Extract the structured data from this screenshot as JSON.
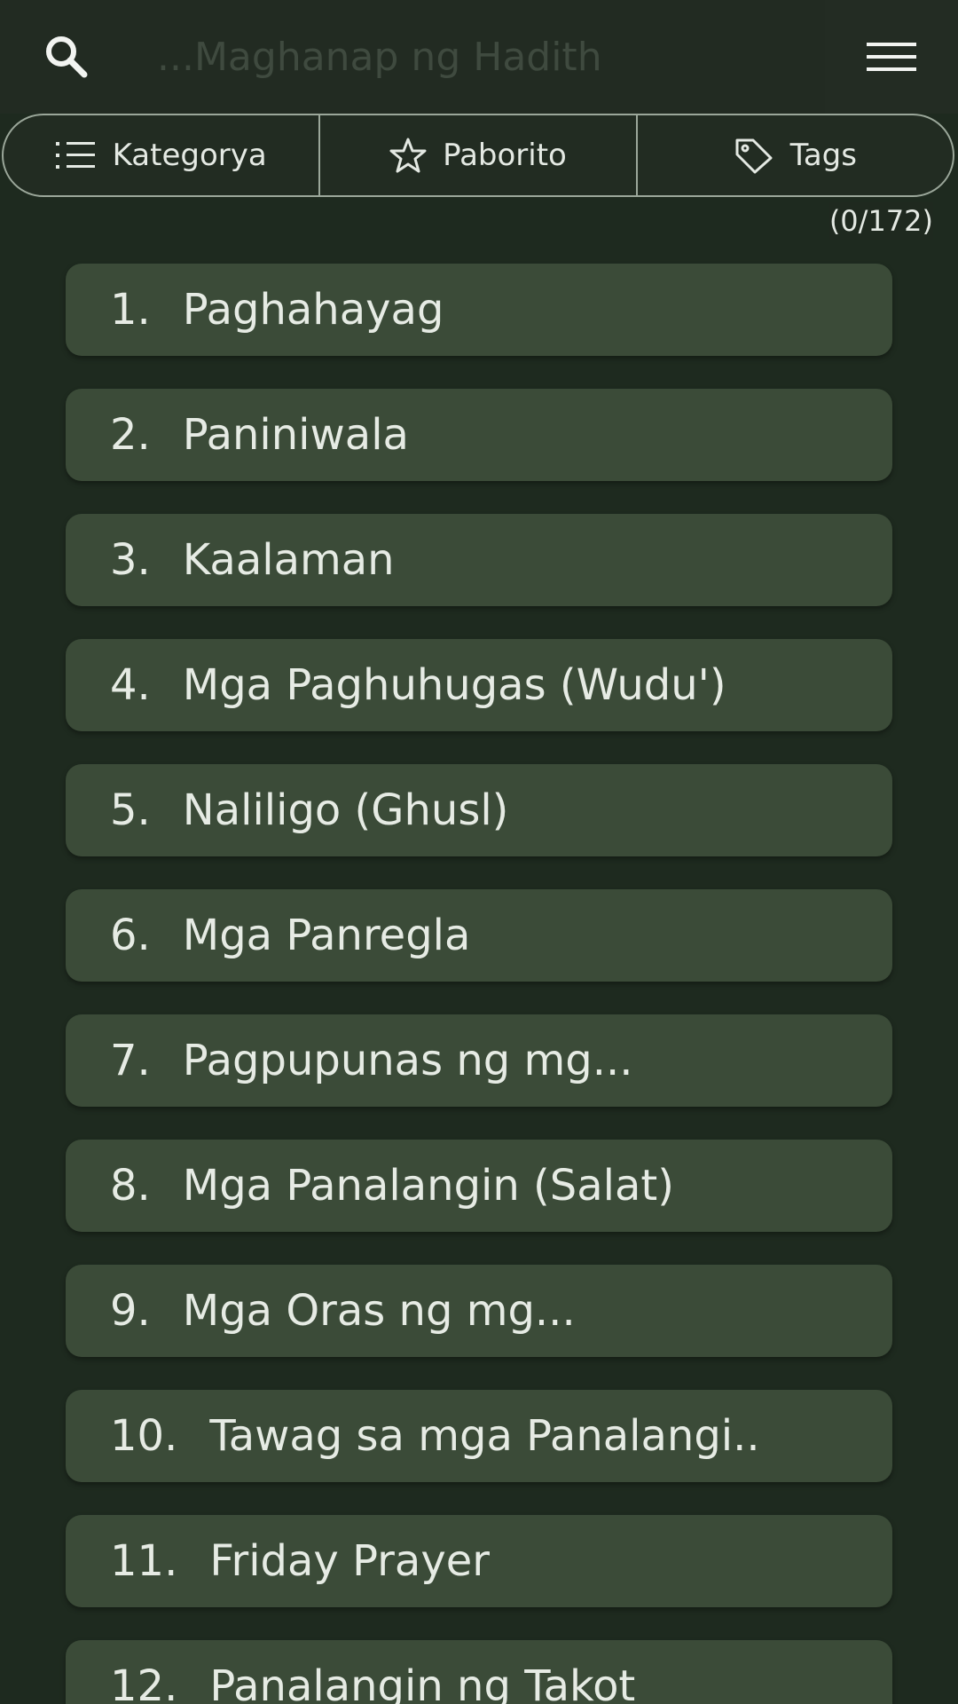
{
  "search": {
    "placeholder": "...Maghanap ng Hadith",
    "icon": "search-icon",
    "menu_icon": "hamburger-menu-icon"
  },
  "segments": [
    {
      "label": "Kategorya",
      "icon": "list-icon"
    },
    {
      "label": "Paborito",
      "icon": "star-icon"
    },
    {
      "label": "Tags",
      "icon": "tag-icon"
    }
  ],
  "counter": "(0/172)",
  "categories": [
    {
      "num": "1.",
      "title": "Paghahayag"
    },
    {
      "num": "2.",
      "title": "Paniniwala"
    },
    {
      "num": "3.",
      "title": "Kaalaman"
    },
    {
      "num": "4.",
      "title": "Mga Paghuhugas (Wudu')"
    },
    {
      "num": "5.",
      "title": "Naliligo (Ghusl)"
    },
    {
      "num": "6.",
      "title": "Mga Panregla"
    },
    {
      "num": "7.",
      "title": "Pagpupunas ng mg..."
    },
    {
      "num": "8.",
      "title": "Mga Panalangin (Salat)"
    },
    {
      "num": "9.",
      "title": "Mga Oras ng mg..."
    },
    {
      "num": "10.",
      "title": "Tawag sa mga Panalangi.."
    },
    {
      "num": "11.",
      "title": "Friday Prayer"
    },
    {
      "num": "12.",
      "title": "Panalangin ng Takot"
    }
  ],
  "colors": {
    "background": "#1e2a1f",
    "card": "#3b4b38",
    "text": "#e6ebe4",
    "border": "#9ba79a"
  }
}
